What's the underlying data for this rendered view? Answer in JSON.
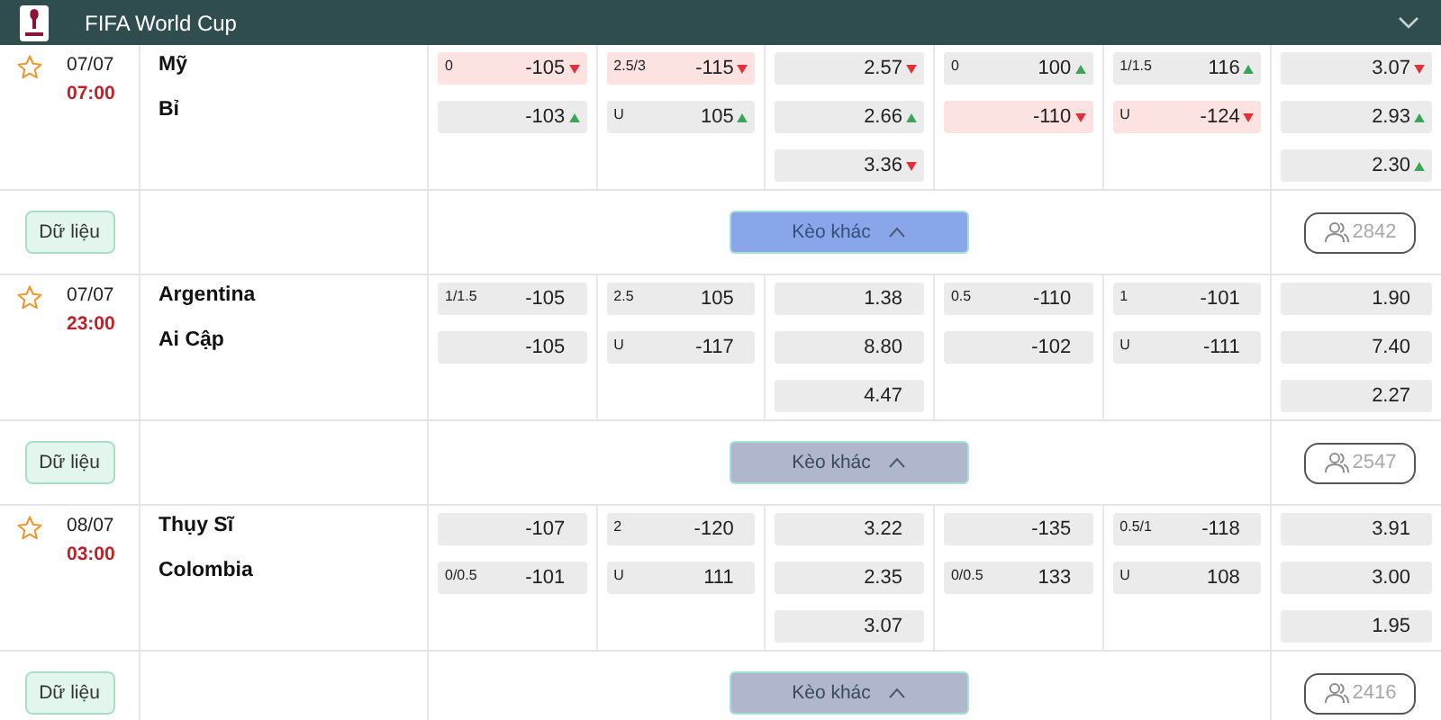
{
  "header": {
    "title": "FIFA World Cup",
    "expanded": true
  },
  "matches": [
    {
      "date": "07/07",
      "time": "07:00",
      "teams": [
        "Mỹ",
        "Bỉ"
      ],
      "data_button": "Dữ liệu",
      "more_button": {
        "label": "Kèo khác",
        "active": true
      },
      "viewers": "2842",
      "markets": [
        [
          {
            "line": "0",
            "value": "-105",
            "rising": false,
            "highlight": true
          },
          {
            "value": "-103",
            "rising": true,
            "highlight": false
          }
        ],
        [
          {
            "line": "2.5/3",
            "value": "-115",
            "rising": false,
            "highlight": true
          },
          {
            "line": "U",
            "value": "105",
            "rising": true,
            "highlight": false
          }
        ],
        [
          {
            "value": "2.57",
            "rising": false,
            "highlight": false
          },
          {
            "value": "2.66",
            "rising": true,
            "highlight": false
          },
          {
            "value": "3.36",
            "rising": false,
            "highlight": false
          }
        ],
        [
          {
            "line": "0",
            "value": "100",
            "rising": true,
            "highlight": false
          },
          {
            "value": "-110",
            "rising": false,
            "highlight": true
          }
        ],
        [
          {
            "line": "1/1.5",
            "value": "116",
            "rising": true,
            "highlight": false
          },
          {
            "line": "U",
            "value": "-124",
            "rising": false,
            "highlight": true
          }
        ],
        [
          {
            "value": "3.07",
            "rising": false,
            "highlight": false
          },
          {
            "value": "2.93",
            "rising": true,
            "highlight": false
          },
          {
            "value": "2.30",
            "rising": true,
            "highlight": false
          }
        ]
      ]
    },
    {
      "date": "07/07",
      "time": "23:00",
      "teams": [
        "Argentina",
        "Ai Cập"
      ],
      "data_button": "Dữ liệu",
      "more_button": {
        "label": "Kèo khác",
        "active": false
      },
      "viewers": "2547",
      "markets": [
        [
          {
            "line": "1/1.5",
            "value": "-105",
            "highlight": false
          },
          {
            "value": "-105",
            "highlight": false
          }
        ],
        [
          {
            "line": "2.5",
            "value": "105",
            "highlight": false
          },
          {
            "line": "U",
            "value": "-117",
            "highlight": false
          }
        ],
        [
          {
            "value": "1.38",
            "highlight": false
          },
          {
            "value": "8.80",
            "highlight": false
          },
          {
            "value": "4.47",
            "highlight": false
          }
        ],
        [
          {
            "line": "0.5",
            "value": "-110",
            "highlight": false
          },
          {
            "value": "-102",
            "highlight": false
          }
        ],
        [
          {
            "line": "1",
            "value": "-101",
            "highlight": false
          },
          {
            "line": "U",
            "value": "-111",
            "highlight": false
          }
        ],
        [
          {
            "value": "1.90",
            "highlight": false
          },
          {
            "value": "7.40",
            "highlight": false
          },
          {
            "value": "2.27",
            "highlight": false
          }
        ]
      ]
    },
    {
      "date": "08/07",
      "time": "03:00",
      "teams": [
        "Thụy Sĩ",
        "Colombia"
      ],
      "data_button": "Dữ liệu",
      "more_button": {
        "label": "Kèo khác",
        "active": false
      },
      "viewers": "2416",
      "markets": [
        [
          {
            "value": "-107",
            "highlight": false
          },
          {
            "line": "0/0.5",
            "value": "-101",
            "highlight": false
          }
        ],
        [
          {
            "line": "2",
            "value": "-120",
            "highlight": false
          },
          {
            "line": "U",
            "value": "111",
            "highlight": false
          }
        ],
        [
          {
            "value": "3.22",
            "highlight": false
          },
          {
            "value": "2.35",
            "highlight": false
          },
          {
            "value": "3.07",
            "highlight": false
          }
        ],
        [
          {
            "value": "-135",
            "highlight": false
          },
          {
            "line": "0/0.5",
            "value": "133",
            "highlight": false
          }
        ],
        [
          {
            "line": "0.5/1",
            "value": "-118",
            "highlight": false
          },
          {
            "line": "U",
            "value": "108",
            "highlight": false
          }
        ],
        [
          {
            "value": "3.91",
            "highlight": false
          },
          {
            "value": "3.00",
            "highlight": false
          },
          {
            "value": "1.95",
            "highlight": false
          }
        ]
      ]
    }
  ]
}
